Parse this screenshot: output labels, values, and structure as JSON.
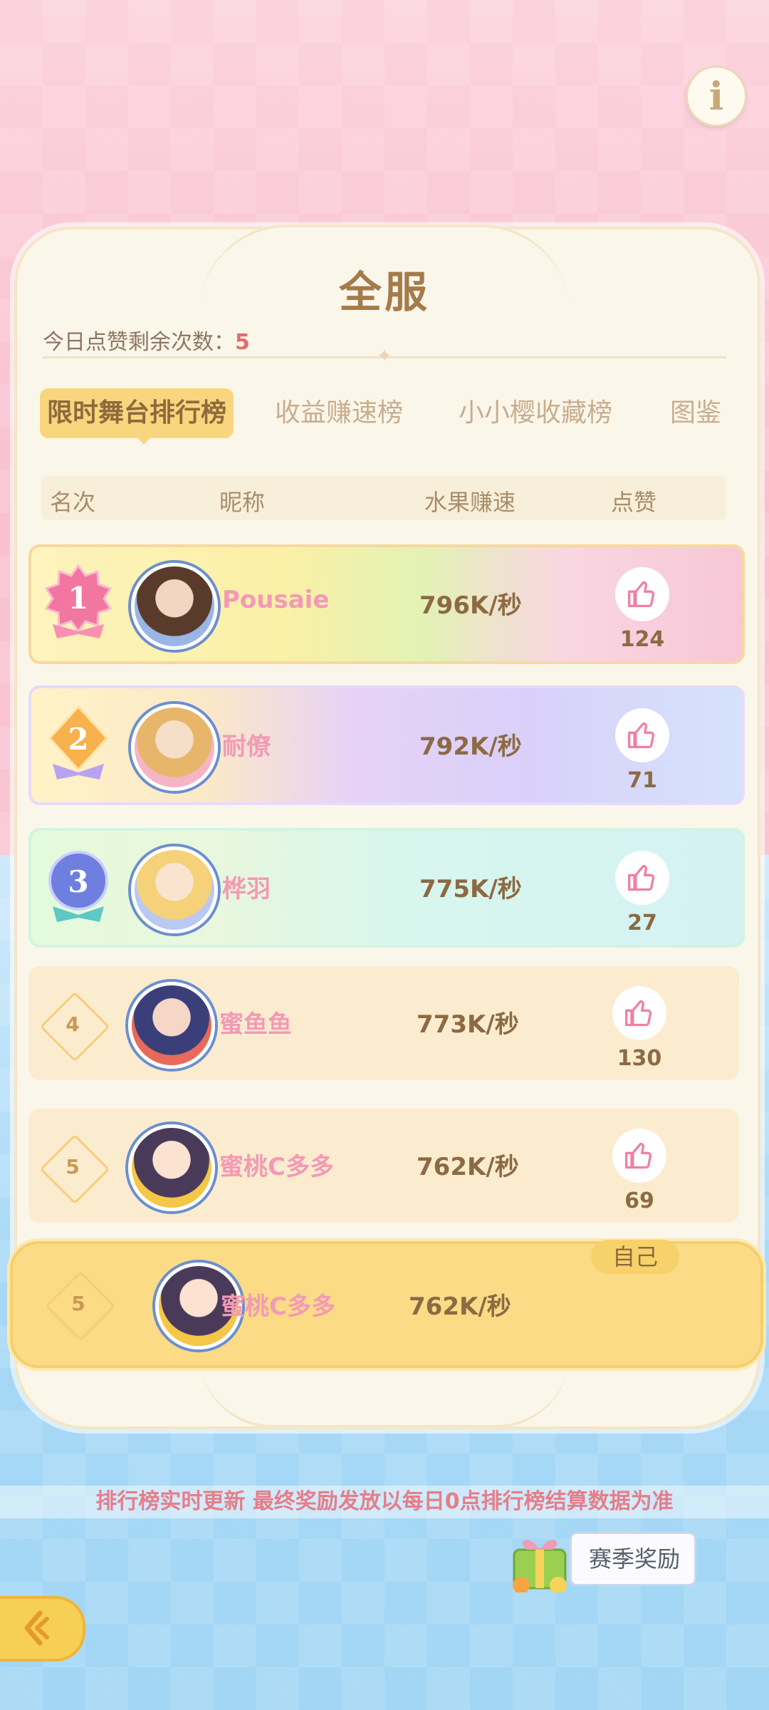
{
  "header": {
    "info_icon": "info-icon",
    "title": "全服",
    "likes_remaining_label": "今日点赞剩余次数：",
    "likes_remaining_value": "5"
  },
  "tabs": [
    {
      "label": "限时舞台排行榜",
      "active": true
    },
    {
      "label": "收益赚速榜",
      "active": false
    },
    {
      "label": "小小樱收藏榜",
      "active": false
    },
    {
      "label": "图鉴",
      "active": false
    }
  ],
  "columns": [
    "名次",
    "昵称",
    "水果赚速",
    "点赞"
  ],
  "rows": [
    {
      "rank": "1",
      "nickname": "Pousaie",
      "speed": "796K/秒",
      "likes": "124"
    },
    {
      "rank": "2",
      "nickname": "耐僚",
      "speed": "792K/秒",
      "likes": "71"
    },
    {
      "rank": "3",
      "nickname": "桦羽",
      "speed": "775K/秒",
      "likes": "27"
    },
    {
      "rank": "4",
      "nickname": "蜜鱼鱼",
      "speed": "773K/秒",
      "likes": "130"
    },
    {
      "rank": "5",
      "nickname": "蜜桃C多多",
      "speed": "762K/秒",
      "likes": "69"
    }
  ],
  "self_row": {
    "tag": "自己",
    "rank": "5",
    "nickname": "蜜桃C多多",
    "speed": "762K/秒"
  },
  "footer": {
    "notice": "排行榜实时更新 最终奖励发放以每日0点排行榜结算数据为准",
    "season_reward_label": "赛季奖励",
    "back_icon": "back-arrow-icon"
  },
  "colors": {
    "accent": "#f9d67e",
    "like_pink": "#f39ab5",
    "text_brown": "#8c6a43"
  }
}
